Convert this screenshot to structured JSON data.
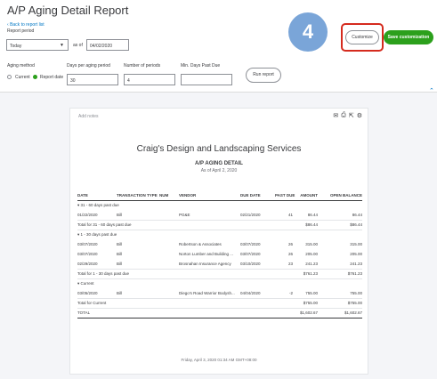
{
  "header": {
    "title": "A/P Aging Detail Report",
    "back_link": "Back to report list",
    "report_period_label": "Report period",
    "period_value": "Today",
    "as_of_label": "as of",
    "as_of_value": "04/02/2020",
    "aging_method_label": "Aging method",
    "current_option": "Current",
    "report_date_option": "Report date",
    "days_per_period_label": "Days per aging period",
    "days_per_period_value": "30",
    "num_periods_label": "Number of periods",
    "num_periods_value": "4",
    "min_days_label": "Min. Days Past Due",
    "min_days_value": "",
    "run_report": "Run report",
    "customize": "Customize",
    "save_customization": "Save customization",
    "step_badge": "4"
  },
  "report": {
    "add_notes": "Add notes",
    "company": "Craig's Design and Landscaping Services",
    "title": "A/P AGING DETAIL",
    "as_of": "As of April 2, 2020",
    "columns": [
      "DATE",
      "TRANSACTION TYPE",
      "NUM",
      "VENDOR",
      "DUE DATE",
      "PAST DUE",
      "AMOUNT",
      "OPEN BALANCE"
    ],
    "groups": [
      {
        "label": "▾ 31 - 60 days past due",
        "rows": [
          {
            "date": "01/22/2020",
            "type": "Bill",
            "num": "",
            "vendor": "PG&E",
            "due": "02/21/2020",
            "past_due": "41",
            "amount": "86.44",
            "open": "86.44"
          }
        ],
        "total_label": "Total for 31 - 60 days past due",
        "total_amount": "$86.44",
        "total_open": "$86.44"
      },
      {
        "label": "▾ 1 - 30 days past due",
        "rows": [
          {
            "date": "03/07/2020",
            "type": "Bill",
            "num": "",
            "vendor": "Robertson & Associates",
            "due": "03/07/2020",
            "past_due": "26",
            "amount": "315.00",
            "open": "315.00"
          },
          {
            "date": "03/07/2020",
            "type": "Bill",
            "num": "",
            "vendor": "Norton Lumber and Building ...",
            "due": "03/07/2020",
            "past_due": "26",
            "amount": "205.00",
            "open": "205.00"
          },
          {
            "date": "02/29/2020",
            "type": "Bill",
            "num": "",
            "vendor": "Brosnahan Insurance Agency",
            "due": "03/10/2020",
            "past_due": "23",
            "amount": "241.23",
            "open": "241.23"
          }
        ],
        "total_label": "Total for 1 - 30 days past due",
        "total_amount": "$761.23",
        "total_open": "$761.23"
      },
      {
        "label": "▾ Current",
        "rows": [
          {
            "date": "03/05/2020",
            "type": "Bill",
            "num": "",
            "vendor": "Diego's Road Warrior Bodysh...",
            "due": "04/04/2020",
            "past_due": "-2",
            "amount": "755.00",
            "open": "755.00"
          }
        ],
        "total_label": "Total for Current",
        "total_amount": "$755.00",
        "total_open": "$755.00"
      }
    ],
    "grand_total_label": "TOTAL",
    "grand_total_amount": "$1,602.67",
    "grand_total_open": "$1,602.67",
    "footer": "Friday, April 3, 2020  01:34 AM GMT+08:00"
  },
  "icons": {
    "email": "envelope-icon",
    "print": "print-icon",
    "export": "export-icon",
    "settings": "gear-icon"
  },
  "colors": {
    "accent_green": "#2ca01c",
    "link_blue": "#0077c5",
    "highlight_red": "#d52b1e",
    "badge_blue": "#7aa5d8"
  }
}
